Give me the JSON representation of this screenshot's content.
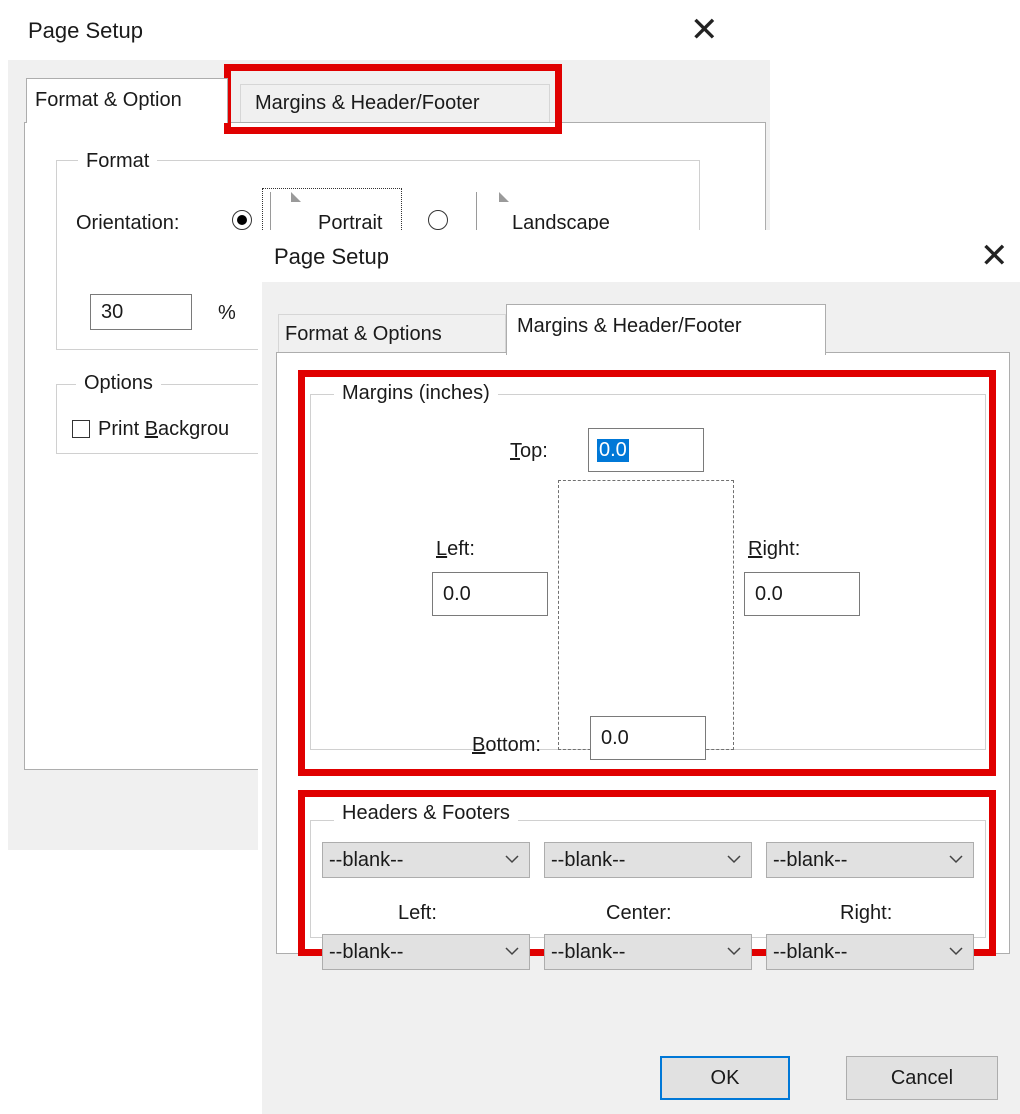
{
  "background_dialog": {
    "title": "Page Setup",
    "close_glyph": "✕",
    "tabs": [
      {
        "label": "Format & Option",
        "active": true
      },
      {
        "label": "Margins & Header/Footer",
        "active": false
      }
    ],
    "format_group": {
      "legend": "Format",
      "orientation_label": "Orientation:",
      "portrait_label": "Portrait",
      "landscape_label": "Landscape",
      "selected_orientation": "Portrait",
      "scale_value": "30",
      "percent_sign": "%"
    },
    "options_group": {
      "legend": "Options",
      "print_background_pre": "Print ",
      "print_background_accel": "B",
      "print_background_post": "ackgrou",
      "print_background_checked": false
    }
  },
  "foreground_dialog": {
    "title": "Page Setup",
    "close_glyph": "✕",
    "tabs": [
      {
        "label": "Format & Options",
        "active": false
      },
      {
        "label": "Margins & Header/Footer",
        "active": true
      }
    ],
    "margins_group": {
      "legend": "Margins (inches)",
      "top": {
        "accel": "T",
        "rest": "op:",
        "value": "0.0"
      },
      "left": {
        "accel": "L",
        "rest": "eft:",
        "value": "0.0"
      },
      "right": {
        "accel": "R",
        "rest": "ight:",
        "value": "0.0"
      },
      "bottom": {
        "accel": "B",
        "rest": "ottom:",
        "value": "0.0"
      }
    },
    "headers_footers_group": {
      "legend": "Headers & Footers",
      "header_selects": [
        "--blank--",
        "--blank--",
        "--blank--"
      ],
      "column_labels": [
        "Left:",
        "Center:",
        "Right:"
      ],
      "footer_selects": [
        "--blank--",
        "--blank--",
        "--blank--"
      ]
    },
    "buttons": {
      "ok": "OK",
      "cancel": "Cancel"
    }
  },
  "colors": {
    "highlight_red": "#e00000",
    "dialog_face": "#f0f0f0",
    "selection_blue": "#0078d7"
  },
  "icons": [
    "close-icon",
    "radio-icon",
    "page-portrait-icon",
    "page-landscape-icon",
    "chevron-down-icon",
    "checkbox-icon"
  ]
}
